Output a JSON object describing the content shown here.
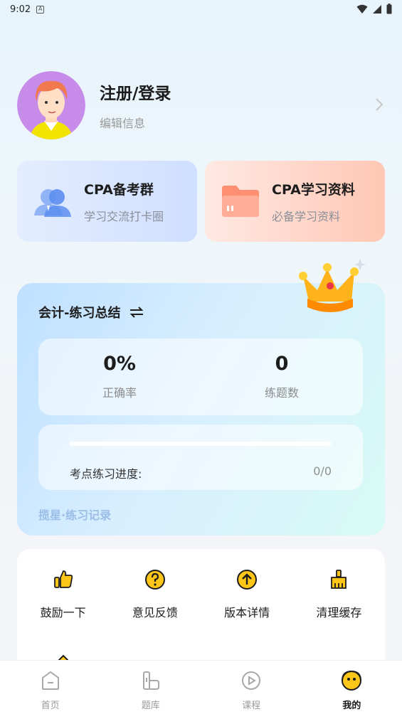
{
  "status_bar": {
    "time": "9:02"
  },
  "profile": {
    "name": "注册/登录",
    "subtitle": "编辑信息"
  },
  "cards": [
    {
      "title": "CPA备考群",
      "subtitle": "学习交流打卡圈",
      "icon": "group-icon"
    },
    {
      "title": "CPA学习资料",
      "subtitle": "必备学习资料",
      "icon": "folder-icon"
    }
  ],
  "summary": {
    "title": "会计-练习总结",
    "accuracy_value": "0%",
    "accuracy_label": "正确率",
    "count_value": "0",
    "count_label": "练题数",
    "progress_label": "考点练习进度:",
    "progress_value": "0/0",
    "progress_fraction": 0,
    "footer": "揽星·练习记录"
  },
  "tools": [
    {
      "label": "鼓励一下",
      "icon": "thumbs-up-icon"
    },
    {
      "label": "意见反馈",
      "icon": "question-icon"
    },
    {
      "label": "版本详情",
      "icon": "upload-arrow-icon"
    },
    {
      "label": "清理缓存",
      "icon": "broom-icon"
    }
  ],
  "nav": [
    {
      "label": "首页",
      "icon": "home-icon"
    },
    {
      "label": "题库",
      "icon": "question-bank-icon"
    },
    {
      "label": "课程",
      "icon": "course-play-icon"
    },
    {
      "label": "我的",
      "icon": "profile-face-icon",
      "active": true
    }
  ],
  "colors": {
    "accent": "#ffc61a",
    "progress": "#4aa0ff"
  }
}
